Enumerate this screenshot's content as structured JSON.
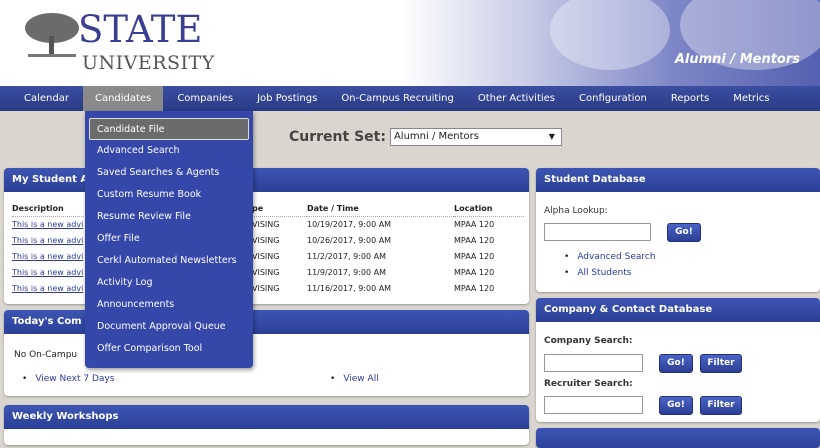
{
  "header": {
    "logo_top": "STATE",
    "logo_bottom": "UNIVERSITY",
    "portal_title": "Alumni / Mentors"
  },
  "nav": {
    "items": [
      "Calendar",
      "Candidates",
      "Companies",
      "Job Postings",
      "On-Campus Recruiting",
      "Other Activities",
      "Configuration",
      "Reports",
      "Metrics"
    ],
    "active": "Candidates"
  },
  "dropdown": {
    "items": [
      "Candidate File",
      "Advanced Search",
      "Saved Searches & Agents",
      "Custom Resume Book",
      "Resume Review File",
      "Offer File",
      "Cerkl Automated Newsletters",
      "Activity Log",
      "Announcements",
      "Document Approval Queue",
      "Offer Comparison Tool"
    ]
  },
  "current_set": {
    "label": "Current Set:",
    "value": "Alumni / Mentors"
  },
  "advising": {
    "title": "My Student A",
    "columns": [
      "Description",
      "pe",
      "Date / Time",
      "Location"
    ],
    "rows": [
      {
        "desc": "This is a new advi",
        "type": "VISING",
        "date": "10/19/2017, 9:00 AM",
        "loc": "MPAA 120"
      },
      {
        "desc": "This is a new advi",
        "type": "VISING",
        "date": "10/26/2017, 9:00 AM",
        "loc": "MPAA 120"
      },
      {
        "desc": "This is a new advi",
        "type": "VISING",
        "date": "11/2/2017, 9:00 AM",
        "loc": "MPAA 120"
      },
      {
        "desc": "This is a new advi",
        "type": "VISING",
        "date": "11/9/2017, 9:00 AM",
        "loc": "MPAA 120"
      },
      {
        "desc": "This is a new advi",
        "type": "VISING",
        "date": "11/16/2017, 9:00 AM",
        "loc": "MPAA 120"
      }
    ]
  },
  "today": {
    "title": "Today's Com",
    "empty": "No On-Campu",
    "link_next": "View Next 7 Days",
    "link_all": "View All"
  },
  "weekly": {
    "title": "Weekly Workshops"
  },
  "student_db": {
    "title": "Student Database",
    "alpha_label": "Alpha Lookup:",
    "go": "Go!",
    "links": [
      "Advanced Search",
      "All Students"
    ]
  },
  "company_db": {
    "title": "Company & Contact Database",
    "company_label": "Company Search:",
    "recruiter_label": "Recruiter Search:",
    "go": "Go!",
    "filter": "Filter"
  }
}
